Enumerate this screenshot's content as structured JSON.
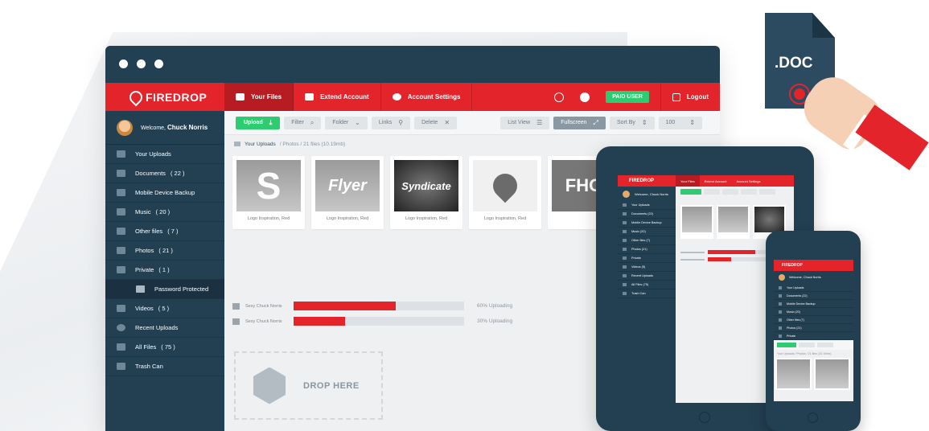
{
  "app": {
    "brand": "FIREDROP"
  },
  "nav": {
    "tabs": [
      {
        "label": "Your Files",
        "icon": "folder-icon"
      },
      {
        "label": "Extend Account",
        "icon": "calendar-icon"
      },
      {
        "label": "Account Settings",
        "icon": "gear-icon"
      }
    ],
    "paid_badge": "PAID USER",
    "logout": "Logout"
  },
  "sidebar": {
    "welcome_prefix": "Welcome,",
    "user_name": "Chuck Norris",
    "items": [
      {
        "label": "Your Uploads",
        "count": ""
      },
      {
        "label": "Documents",
        "count": "( 22 )"
      },
      {
        "label": "Mobile Device Backup",
        "count": ""
      },
      {
        "label": "Music",
        "count": "( 20 )"
      },
      {
        "label": "Other files",
        "count": "( 7 )"
      },
      {
        "label": "Photos",
        "count": "( 21 )"
      },
      {
        "label": "Private",
        "count": "( 1 )"
      },
      {
        "label": "Password Protected",
        "count": ""
      },
      {
        "label": "Videos",
        "count": "( 5 )"
      },
      {
        "label": "Recent Uploads",
        "count": ""
      },
      {
        "label": "All Files",
        "count": "( 75 )"
      },
      {
        "label": "Trash Can",
        "count": ""
      }
    ]
  },
  "toolbar": {
    "upload": "Upload",
    "filter": "Filter",
    "folder": "Folder",
    "links": "Links",
    "delete": "Delete",
    "list_view": "List View",
    "fullscreen": "Fullscreen",
    "sort_by": "Sort By",
    "per_page": "100"
  },
  "breadcrumb": {
    "root": "Your Uploads",
    "folder": "Photos",
    "summary": "21 files (10.19mb)"
  },
  "files": [
    {
      "thumb": "S",
      "caption": "Logo Inspiration, Red"
    },
    {
      "thumb": "Flyer",
      "caption": "Logo Inspiration, Red"
    },
    {
      "thumb": "Syndicate",
      "caption": "Logo Inspiration, Red"
    },
    {
      "thumb": "",
      "caption": "Logo Inspiration, Red"
    },
    {
      "thumb": "FHO",
      "caption": ""
    }
  ],
  "uploads": [
    {
      "name": "Sexy Chuck Norris",
      "progress": 0.6,
      "status": "60% Uploading"
    },
    {
      "name": "Sexy Chuck Norris",
      "progress": 0.3,
      "status": "30% Uploading"
    }
  ],
  "dropzone": {
    "label": "DROP HERE"
  },
  "doc_icon": {
    "label": ".DOC"
  },
  "tablet": {
    "brand": "FIREDROP",
    "tabs": [
      "Your Files",
      "Extend Account",
      "Account Settings"
    ],
    "welcome": "Welcome, Chuck Norris",
    "items": [
      "Your Uploads",
      "Documents (22)",
      "Mobile Device Backup",
      "Music (20)",
      "Other files (7)",
      "Photos (21)",
      "Private",
      "Videos (5)",
      "Recent Uploads",
      "All Files (75)",
      "Trash Can"
    ]
  },
  "phone": {
    "brand": "FIREDROP",
    "welcome": "Welcome, Chuck Norris",
    "items": [
      "Your Uploads",
      "Documents (22)",
      "Mobile Device Backup",
      "Music (20)",
      "Other files (7)",
      "Photos (21)",
      "Private"
    ],
    "crumb": "Your Uploads / Photos / 21 files (10.19mb)"
  },
  "colors": {
    "brand_red": "#e3242b",
    "navy": "#233f52",
    "green": "#2ecc71"
  }
}
